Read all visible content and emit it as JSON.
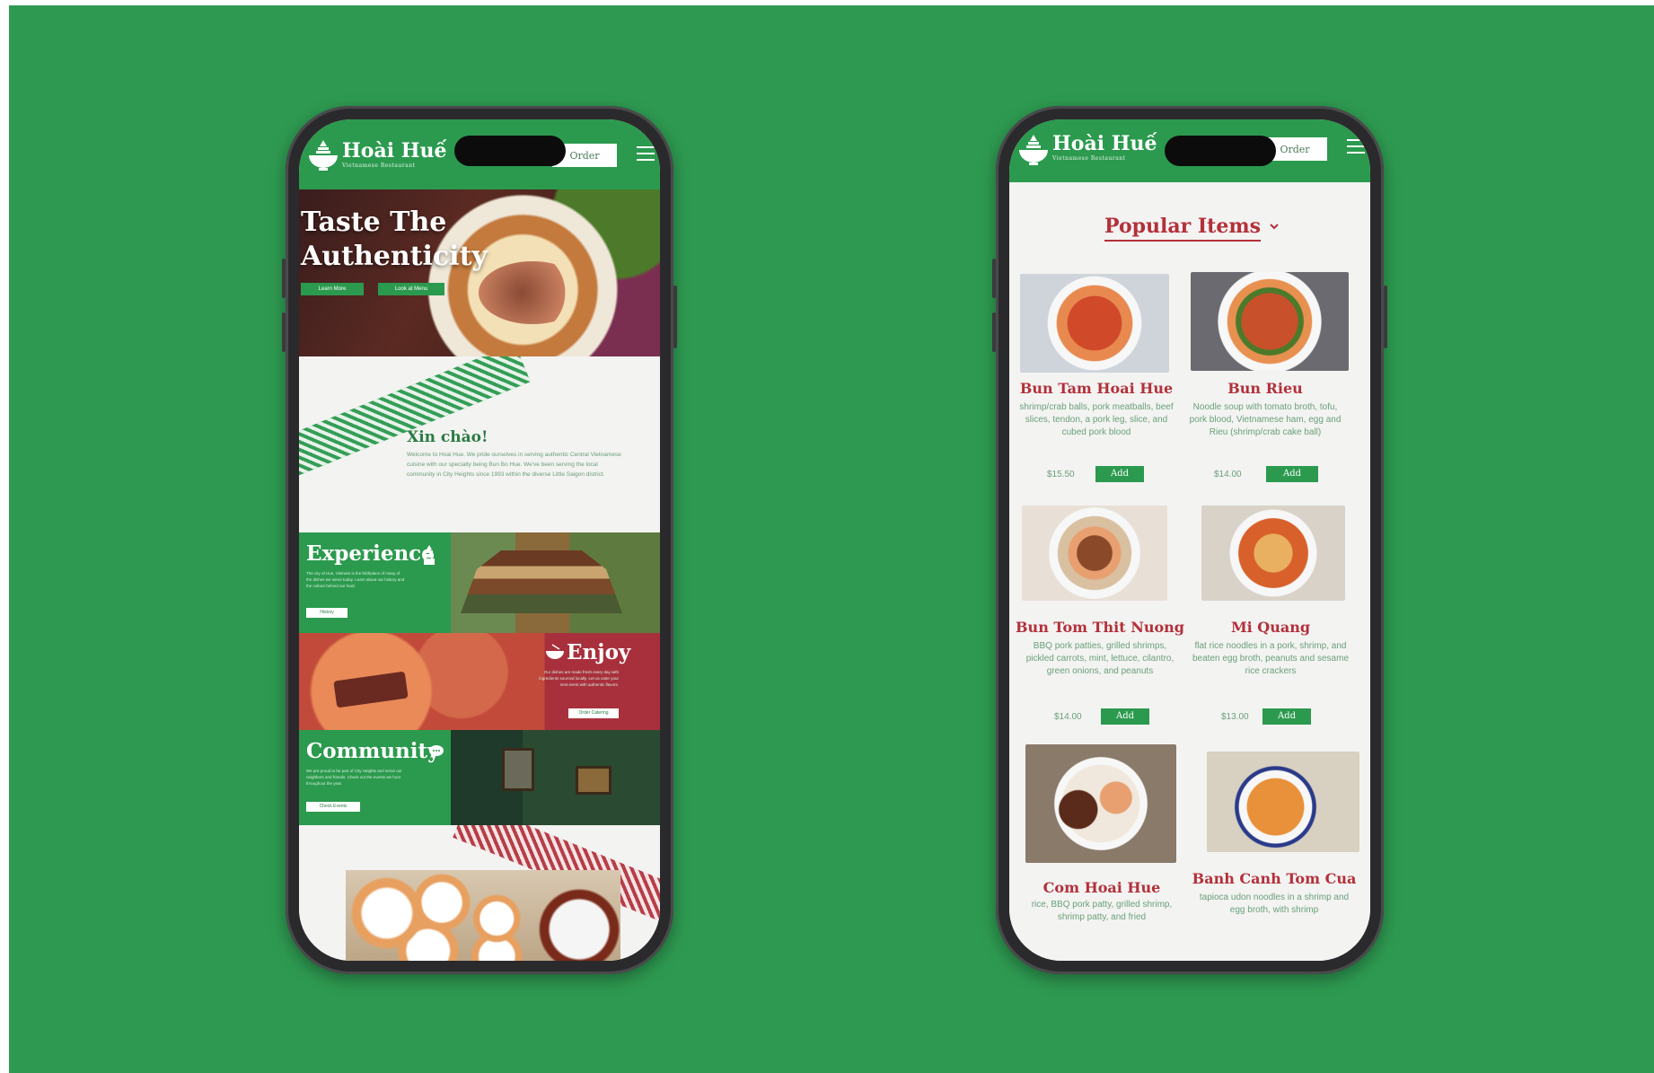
{
  "left_phone": {
    "header": {
      "brand": "Hoài Huế",
      "brand_sub": "Vietnamese Restaurant",
      "order_label": "Order"
    },
    "hero": {
      "title": "Taste The Authenticity",
      "btn_learn": "Learn More",
      "btn_menu": "Look at Menu"
    },
    "welcome": {
      "title": "Xin chào!",
      "text": "Welcome to Hoai Hue. We pride ourselves in serving authentic Central Vietnamese cuisine with our specialty being Bun Bo Hue. We've been serving the local community in City Heights since 1993 within the diverse Little Saigon district."
    },
    "experience": {
      "title": "Experience",
      "text": "The city of Hue, Vietnam is the birthplace of many of the dishes we serve today. Learn about our history and the culture behind our food.",
      "btn": "History"
    },
    "enjoy": {
      "title": "Enjoy",
      "text": "Our dishes are made fresh every day with ingredients sourced locally. Let us cater your next event with authentic flavors.",
      "btn": "Order Catering"
    },
    "community": {
      "title": "Community",
      "text": "We are proud to be part of City Heights and serve our neighbors and friends. Check out the events we host throughout the year.",
      "btn": "Check Events"
    }
  },
  "right_phone": {
    "header": {
      "brand": "Hoài Huế",
      "brand_sub": "Vietnamese Restaurant",
      "order_label": "Order"
    },
    "section_title": "Popular Items",
    "items": [
      {
        "name": "Bun Tam Hoai Hue",
        "desc": "shrimp/crab balls, pork meatballs, beef slices, tendon, a pork leg, slice, and cubed pork blood",
        "price": "$15.50",
        "add": "Add"
      },
      {
        "name": "Bun Rieu",
        "desc": "Noodle soup with tomato broth, tofu, pork blood, Vietnamese ham, egg and Rieu (shrimp/crab cake ball)",
        "price": "$14.00",
        "add": "Add"
      },
      {
        "name": "Bun Tom Thit Nuong",
        "desc": "BBQ pork patties, grilled shrimps, pickled carrots, mint, lettuce, cilantro, green onions, and peanuts",
        "price": "$14.00",
        "add": "Add"
      },
      {
        "name": "Mi Quang",
        "desc": "flat rice noodles in a pork, shrimp, and beaten egg broth, peanuts and sesame rice crackers",
        "price": "$13.00",
        "add": "Add"
      },
      {
        "name": "Com Hoai Hue",
        "desc": "rice, BBQ pork patty, grilled shrimp, shrimp patty, and fried",
        "price": "",
        "add": ""
      },
      {
        "name": "Banh Canh Tom Cua",
        "desc": "tapioca udon noodles in a shrimp and egg broth, with shrimp",
        "price": "",
        "add": ""
      }
    ]
  },
  "colors": {
    "stage_green": "#2e9a51",
    "brand_green": "#2b9a4e",
    "accent_red": "#b3303a"
  }
}
